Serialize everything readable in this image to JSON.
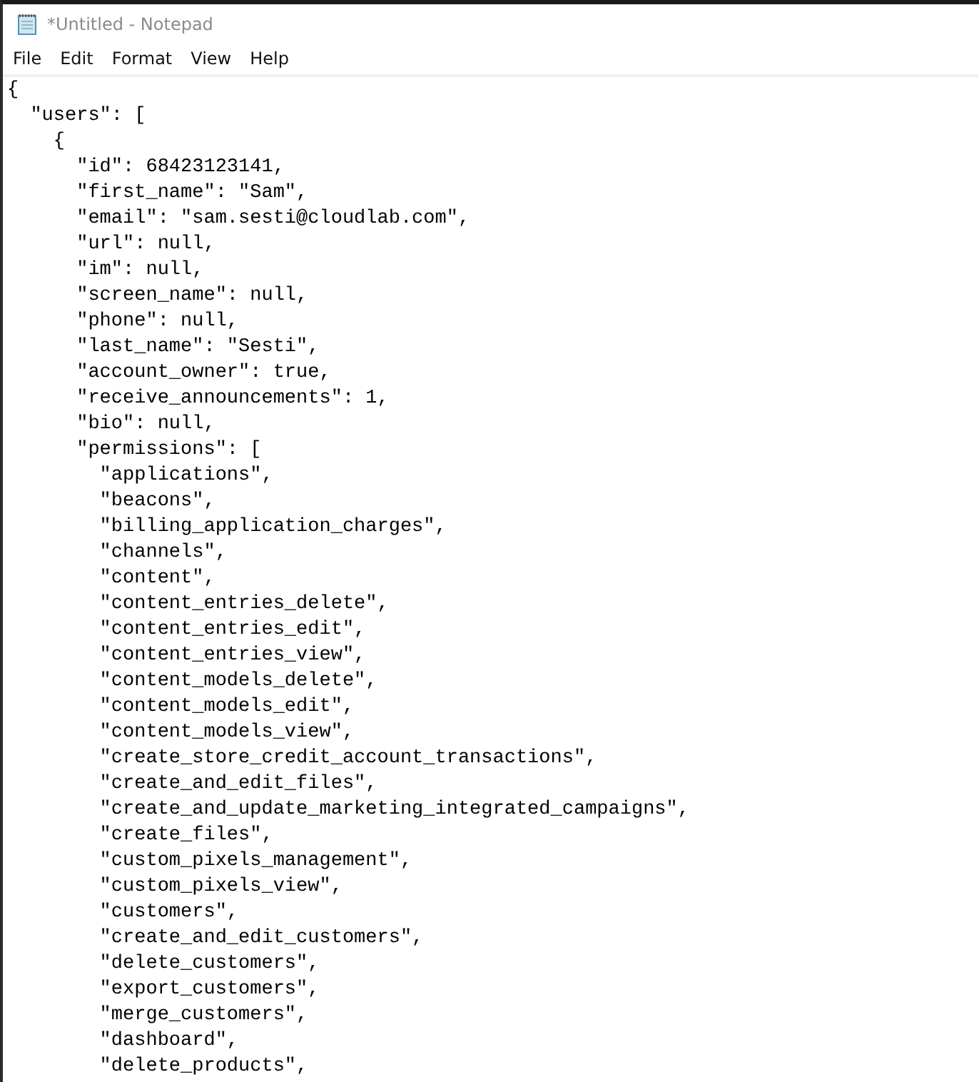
{
  "window": {
    "title": "*Untitled - Notepad"
  },
  "menu": [
    "File",
    "Edit",
    "Format",
    "View",
    "Help"
  ],
  "editor": {
    "lines": [
      "{",
      "  \"users\": [",
      "    {",
      "      \"id\": 68423123141,",
      "      \"first_name\": \"Sam\",",
      "      \"email\": \"sam.sesti@cloudlab.com\",",
      "      \"url\": null,",
      "      \"im\": null,",
      "      \"screen_name\": null,",
      "      \"phone\": null,",
      "      \"last_name\": \"Sesti\",",
      "      \"account_owner\": true,",
      "      \"receive_announcements\": 1,",
      "      \"bio\": null,",
      "      \"permissions\": [",
      "        \"applications\",",
      "        \"beacons\",",
      "        \"billing_application_charges\",",
      "        \"channels\",",
      "        \"content\",",
      "        \"content_entries_delete\",",
      "        \"content_entries_edit\",",
      "        \"content_entries_view\",",
      "        \"content_models_delete\",",
      "        \"content_models_edit\",",
      "        \"content_models_view\",",
      "        \"create_store_credit_account_transactions\",",
      "        \"create_and_edit_files\",",
      "        \"create_and_update_marketing_integrated_campaigns\",",
      "        \"create_files\",",
      "        \"custom_pixels_management\",",
      "        \"custom_pixels_view\",",
      "        \"customers\",",
      "        \"create_and_edit_customers\",",
      "        \"delete_customers\",",
      "        \"export_customers\",",
      "        \"merge_customers\",",
      "        \"dashboard\",",
      "        \"delete_products\","
    ]
  }
}
